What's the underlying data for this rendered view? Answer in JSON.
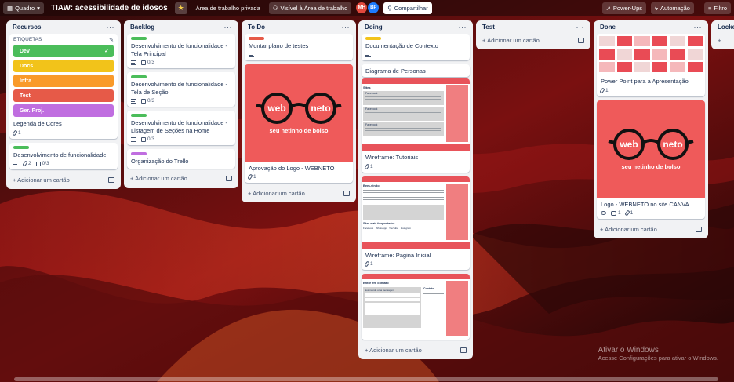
{
  "topbar": {
    "view_label": "Quadro",
    "board_title": "TIAW: acessibilidade de idosos",
    "workspace_label": "Área de trabalho privada",
    "visibility_label": "Visível à Área de trabalho",
    "members": [
      {
        "initials": "MH",
        "color": "#e2483d"
      },
      {
        "initials": "BP",
        "color": "#1d7afc"
      }
    ],
    "share_label": "Compartilhar",
    "powerups_label": "Power-Ups",
    "automation_label": "Automação",
    "filter_label": "Filtro"
  },
  "lists": {
    "recursos": {
      "title": "Recursos",
      "etiquetas_title": "ETIQUETAS",
      "tags": [
        {
          "name": "Dev",
          "color": "#4bce97"
        },
        {
          "name": "Docs",
          "color": "#f5cd47"
        },
        {
          "name": "Infra",
          "color": "#fea362"
        },
        {
          "name": "Test",
          "color": "#f87168"
        },
        {
          "name": "Ger. Proj.",
          "color": "#9f8fef"
        }
      ],
      "card1_title": "Legenda de Cores",
      "card1_attach": "1",
      "card2_title": "Desenvolvimento de funcionalidade",
      "card2_attach": "2",
      "card2_check": "0/3",
      "add_label": "Adicionar um cartão"
    },
    "backlog": {
      "title": "Backlog",
      "cards": [
        {
          "title": "Desenvolvimento de funcionalidade - Tela Principal",
          "check": "0/3"
        },
        {
          "title": "Desenvolvimento de funcionalidade - Tela de Seção",
          "check": "0/3"
        },
        {
          "title": "Desenvolvimento de funcionalidade - Listagem de Seções na Home",
          "check": "0/3"
        },
        {
          "title": "Organização do Trello"
        }
      ],
      "add_label": "Adicionar um cartão"
    },
    "todo": {
      "title": "To Do",
      "card1_title": "Montar plano de testes",
      "logo_text_left": "web",
      "logo_text_right": "neto",
      "logo_sub": "seu netinho de bolso",
      "card2_title": "Aprovação do Logo - WEBNETO",
      "card2_attach": "1",
      "add_label": "Adicionar um cartão"
    },
    "doing": {
      "title": "Doing",
      "card1_title": "Documentação de Contexto",
      "card2_title": "Diagrama de Personas",
      "card3_title": "Wireframe: Tutoriais",
      "card3_attach": "1",
      "card4_title": "Wireframe: Pagina Inicial",
      "card4_attach": "1",
      "add_label": "Adicionar um cartão"
    },
    "test": {
      "title": "Test",
      "add_label": "Adicionar um cartão"
    },
    "done": {
      "title": "Done",
      "card1_title": "Power Point para a Apresentação",
      "card1_attach": "1",
      "logo_text_left": "web",
      "logo_text_right": "neto",
      "logo_sub": "seu netinho de bolso",
      "card2_title": "Logo - WEBNETO no site CANVA",
      "card2_comments": "1",
      "card2_attach": "1",
      "add_label": "Adicionar um cartão"
    },
    "locked": {
      "title": "Locked"
    }
  },
  "wireframes": {
    "tutoriais_heading": "Sites",
    "tutoriais_item": "Facebook",
    "inicial_heading": "Bem-vindo!",
    "inicial_sites": "Sites mais frequentados",
    "inicial_icons": [
      "Facebook",
      "WhatsApp",
      "YouTube",
      "Instagram"
    ],
    "contato_heading": "Entre em contato",
    "contato_form": "Nos mande uma mensagem",
    "contato_side": "Contato"
  },
  "watermark": {
    "line1": "Ativar o Windows",
    "line2": "Acesse Configurações para ativar o Windows."
  }
}
